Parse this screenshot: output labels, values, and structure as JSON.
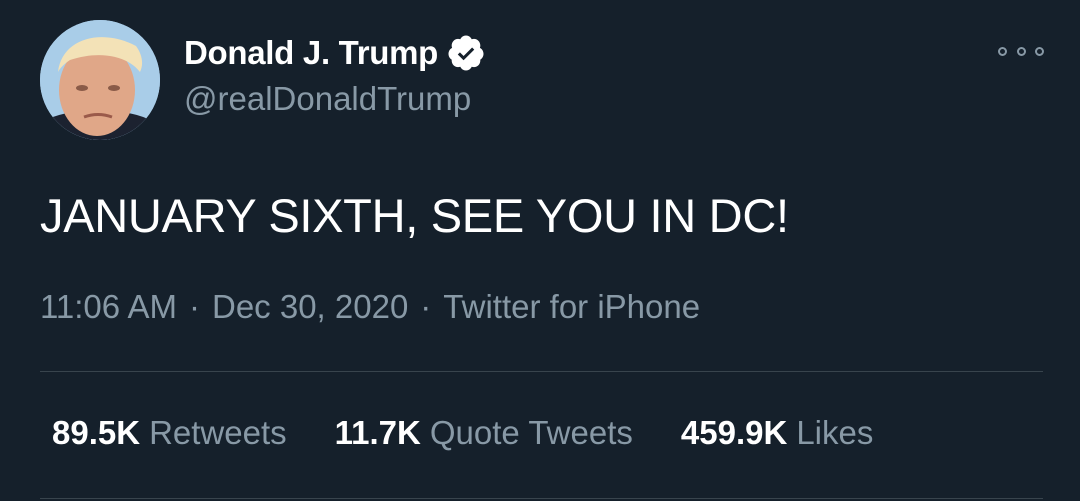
{
  "tweet": {
    "author": {
      "display_name": "Donald J. Trump",
      "handle": "@realDonaldTrump",
      "verified": true,
      "avatar": "profile-photo"
    },
    "text": "JANUARY SIXTH, SEE YOU IN DC!",
    "time": "11:06 AM",
    "separator": "·",
    "date": "Dec 30, 2020",
    "source": "Twitter for iPhone",
    "stats": [
      {
        "count": "89.5K",
        "label": "Retweets"
      },
      {
        "count": "11.7K",
        "label": "Quote Tweets"
      },
      {
        "count": "459.9K",
        "label": "Likes"
      }
    ]
  },
  "icons": {
    "verified": "verified-badge-icon",
    "more": "more-options-icon"
  },
  "colors": {
    "background": "#15202b",
    "primary_text": "#ffffff",
    "secondary_text": "#8899a6",
    "divider": "#38444d"
  }
}
